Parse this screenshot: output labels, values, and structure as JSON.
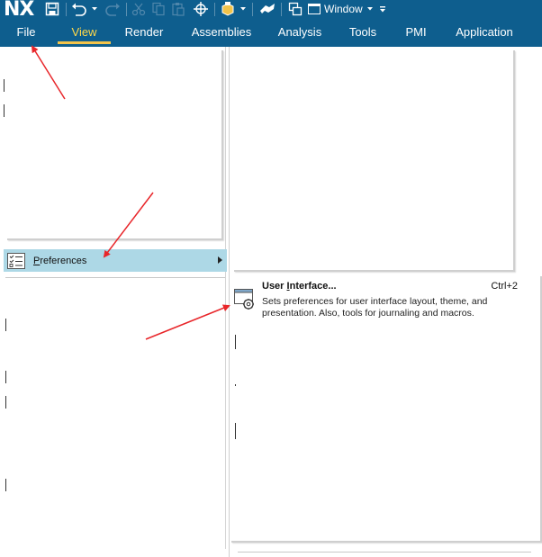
{
  "app": {
    "logo": "NX"
  },
  "quick_access": {
    "window_label": "Window"
  },
  "ribbon": {
    "tabs": [
      {
        "label": "File"
      },
      {
        "label": "View"
      },
      {
        "label": "Render"
      },
      {
        "label": "Assemblies"
      },
      {
        "label": "Analysis"
      },
      {
        "label": "Tools"
      },
      {
        "label": "PMI"
      },
      {
        "label": "Application"
      }
    ],
    "active_tab": "View"
  },
  "file_menu": {
    "preferences": {
      "label_prefix": "P",
      "label_rest": "references"
    }
  },
  "submenu": {
    "user_interface": {
      "title_prefix": "User ",
      "title_underlined": "I",
      "title_rest": "nterface...",
      "shortcut": "Ctrl+2",
      "description": "Sets preferences for user interface layout, theme, and presentation. Also, tools for journaling and macros."
    }
  },
  "colors": {
    "titlebar": "#0e5e8e",
    "active_tab": "#ffd84a",
    "highlight": "#add8e6",
    "arrow": "#e8262a"
  }
}
